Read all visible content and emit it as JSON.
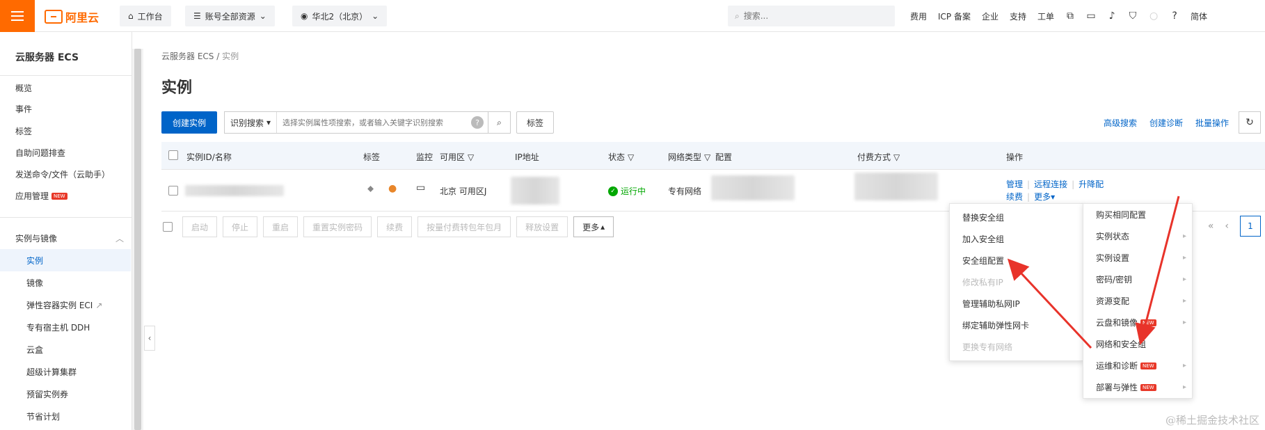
{
  "topbar": {
    "brand": "阿里云",
    "workbench": "工作台",
    "resources": "账号全部资源",
    "region": "华北2（北京）",
    "search_placeholder": "搜索...",
    "links": [
      "费用",
      "ICP 备案",
      "企业",
      "支持",
      "工单"
    ],
    "lang": "简体"
  },
  "sidebar": {
    "title": "云服务器 ECS",
    "items": [
      "概览",
      "事件",
      "标签",
      "自助问题排查",
      "发送命令/文件（云助手）",
      "应用管理"
    ],
    "new_badge": "NEW",
    "group": "实例与镜像",
    "sub_items": [
      "实例",
      "镜像",
      "弹性容器实例 ECI",
      "专有宿主机 DDH",
      "云盒",
      "超级计算集群",
      "预留实例券",
      "节省计划"
    ]
  },
  "main": {
    "breadcrumb_root": "云服务器 ECS",
    "breadcrumb_sep": "/",
    "breadcrumb_current": "实例",
    "title": "实例",
    "create_btn": "创建实例",
    "search_select": "识别搜索",
    "search_placeholder": "选择实例属性项搜索，或者输入关键字识别搜索",
    "help": "?",
    "tag_btn": "标签",
    "toolbar_links": [
      "高级搜索",
      "创建诊断",
      "批量操作"
    ]
  },
  "table": {
    "headers": {
      "id": "实例ID/名称",
      "tags": "标签",
      "monitor": "监控",
      "zone": "可用区",
      "ip": "IP地址",
      "status": "状态",
      "network": "网络类型",
      "config": "配置",
      "billing": "付费方式",
      "ops": "操作"
    },
    "row": {
      "zone": "北京 可用区J",
      "status": "运行中",
      "network": "专有网络",
      "ops": [
        "管理",
        "远程连接",
        "升降配"
      ],
      "ops2": [
        "续费",
        "更多"
      ]
    }
  },
  "bulk": {
    "buttons": [
      "启动",
      "停止",
      "重启",
      "重置实例密码",
      "续费",
      "按量付费转包年包月",
      "释放设置"
    ],
    "more": "更多"
  },
  "pager": {
    "page": "1"
  },
  "menu_right": {
    "items": [
      "购买相同配置",
      "实例状态",
      "实例设置",
      "密码/密钥",
      "资源变配",
      "云盘和镜像",
      "网络和安全组",
      "运维和诊断",
      "部署与弹性"
    ],
    "new_badge": "NEW"
  },
  "menu_left": {
    "items": [
      "替换安全组",
      "加入安全组",
      "安全组配置",
      "修改私有IP",
      "管理辅助私网IP",
      "绑定辅助弹性网卡",
      "更换专有网络"
    ]
  },
  "watermark": "@稀土掘金技术社区",
  "colors": {
    "brand": "#ff6a00",
    "primary": "#0064c8",
    "success": "#00a700",
    "arrow": "#e8332a"
  }
}
